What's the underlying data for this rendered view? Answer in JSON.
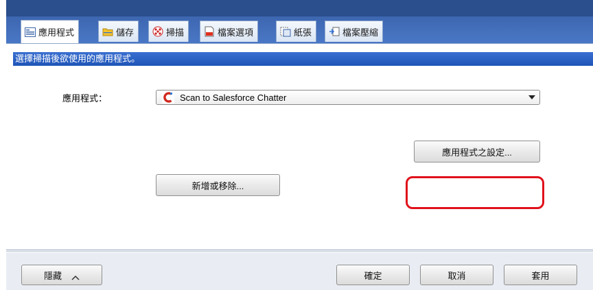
{
  "tabs": [
    {
      "label": "應用程式",
      "icon": "application-list-icon",
      "active": true
    },
    {
      "label": "儲存",
      "icon": "folder-icon",
      "active": false
    },
    {
      "label": "掃描",
      "icon": "scan-pattern-icon",
      "active": false
    },
    {
      "label": "檔案選項",
      "icon": "file-options-icon",
      "active": false
    },
    {
      "label": "紙張",
      "icon": "paper-icon",
      "active": false
    },
    {
      "label": "檔案壓縮",
      "icon": "file-compression-icon",
      "active": false
    }
  ],
  "panel": {
    "description": "選擇掃描後欲使用的應用程式。",
    "app_label": "應用程式：",
    "app_select": {
      "selected": "Scan to Salesforce Chatter",
      "icon": "salesforce-chatter-logo-icon"
    },
    "app_settings_button": "應用程式之設定...",
    "add_remove_button": "新增或移除..."
  },
  "footer": {
    "hide_button": "隱藏",
    "ok_button": "確定",
    "cancel_button": "取消",
    "apply_button": "套用"
  },
  "colors": {
    "tab_bar": "#3d66b0",
    "description_bar": "#2a62c6",
    "highlight": "#e0101a",
    "footer": "#e9edf3"
  }
}
